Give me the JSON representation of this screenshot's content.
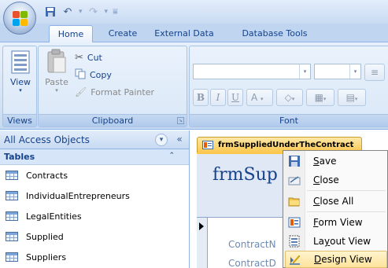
{
  "tabs": [
    {
      "label": "Home",
      "active": true
    },
    {
      "label": "Create",
      "active": false
    },
    {
      "label": "External Data",
      "active": false
    },
    {
      "label": "Database Tools",
      "active": false
    }
  ],
  "ribbon": {
    "views": {
      "button_label": "View",
      "group_label": "Views"
    },
    "clipboard": {
      "paste_label": "Paste",
      "cut_label": "Cut",
      "copy_label": "Copy",
      "format_painter_label": "Format Painter",
      "group_label": "Clipboard"
    },
    "font": {
      "group_label": "Font",
      "bold": "B",
      "italic": "I",
      "underline": "U",
      "font_color": "A"
    }
  },
  "nav_pane": {
    "header": "All Access Objects",
    "group_label": "Tables",
    "items": [
      "Contracts",
      "IndividualEntrepreneurs",
      "LegalEntities",
      "Supplied",
      "Suppliers"
    ]
  },
  "document": {
    "tab_label": "frmSuppliedUnderTheContract",
    "form_title": "frmSup",
    "field_labels": [
      "ContractN",
      "ContractD"
    ]
  },
  "context_menu": {
    "items": [
      {
        "label": "Save",
        "icon": "save-icon",
        "hover": false
      },
      {
        "label": "Close",
        "icon": "close-doc-icon",
        "hover": false
      },
      {
        "label": "Close All",
        "icon": "folder-icon",
        "hover": false
      },
      {
        "label": "Form View",
        "icon": "form-view-icon",
        "hover": false
      },
      {
        "label": "Layout View",
        "icon": "layout-view-icon",
        "hover": false
      },
      {
        "label": "Design View",
        "icon": "design-view-icon",
        "hover": true
      }
    ]
  },
  "colors": {
    "ribbon_text": "#15428b",
    "hover_gold": "#fde39b",
    "doc_tab": "#fbc74f"
  }
}
